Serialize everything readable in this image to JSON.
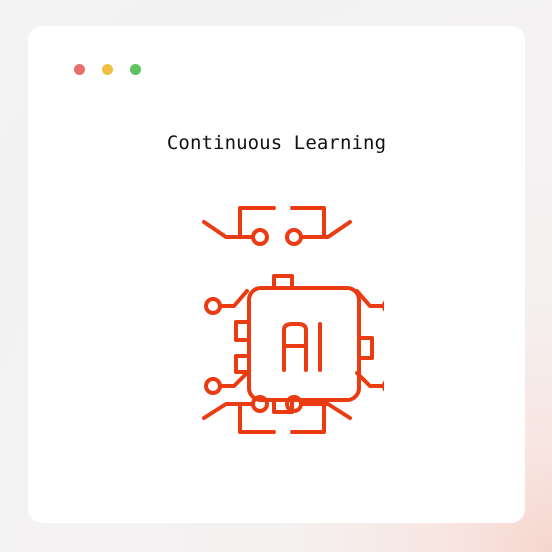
{
  "window": {
    "controls": [
      {
        "name": "close",
        "color": "#e76f6b"
      },
      {
        "name": "minimize",
        "color": "#efbf3f"
      },
      {
        "name": "maximize",
        "color": "#5fc15f"
      }
    ]
  },
  "content": {
    "title": "Continuous Learning",
    "icon": {
      "name": "ai-chip-icon",
      "label": "AI",
      "color": "#ea3b12"
    }
  }
}
